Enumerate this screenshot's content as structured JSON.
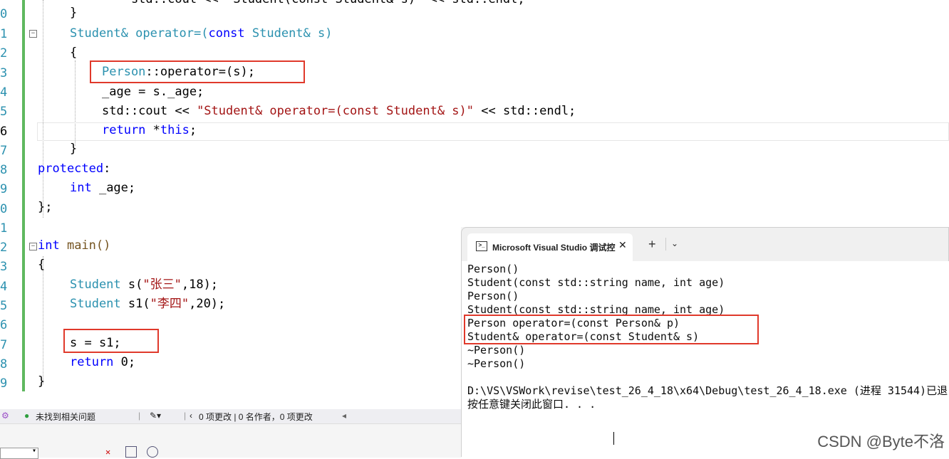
{
  "editor": {
    "line_numbers": [
      "0",
      "1",
      "2",
      "3",
      "4",
      "5",
      "6",
      "7",
      "8",
      "9",
      "0",
      "1",
      "2",
      "3",
      "4",
      "5",
      "6",
      "7",
      "8",
      "9"
    ],
    "line0": "    std::cout << \"Student(const Student& s)\" << std::endl;",
    "line1": "}",
    "l_student_ref": "Student& operator=(",
    "l_const": "const",
    "l_student_s": " Student& s)",
    "brace_open": "{",
    "person": "Person",
    "person_op": "::operator=(s);",
    "age_assign": "_age = s._age;",
    "cout_a": "std::cout << ",
    "cout_str": "\"Student& operator=(const Student& s)\"",
    "cout_b": " << std::endl;",
    "return_kw": "return",
    "return_this_a": " *",
    "this_kw": "this",
    "return_this_b": ";",
    "brace_close": "}",
    "protected": "protected",
    "colon": ":",
    "int_kw": "int",
    "age_decl": " _age;",
    "class_end": "};",
    "main_int": "int",
    "main_rest": " main()",
    "main_open": "{",
    "student_kw1": "Student",
    "s_decl_a": " s(",
    "s_decl_str": "\"张三\"",
    "s_decl_b": ",18);",
    "student_kw2": "Student",
    "s1_decl_a": " s1(",
    "s1_decl_str": "\"李四\"",
    "s1_decl_b": ",20);",
    "assign": "s = s1;",
    "ret_main_kw": "return",
    "ret_main_rest": " 0;",
    "main_close": "}"
  },
  "statusbar": {
    "issues": "未找到相关问题",
    "changes": "0 项更改 | 0 名作者，0 项更改"
  },
  "terminal": {
    "tab_title": "Microsoft Visual Studio 调试控",
    "lines": [
      "Person()",
      "Student(const std::string name, int age)",
      "Person()",
      "Student(const std::string name, int age)",
      "Person operator=(const Person& p)",
      "Student& operator=(const Student& s)",
      "~Person()",
      "~Person()",
      "",
      "D:\\VS\\VSWork\\revise\\test_26_4_18\\x64\\Debug\\test_26_4_18.exe (进程 31544)已退",
      "按任意键关闭此窗口. . ."
    ]
  },
  "watermark": "CSDN @Byte不洛",
  "colors": {
    "accent_green": "#5fb85f",
    "highlight_red": "#e0392b",
    "keyword_blue": "#0000ff",
    "type_teal": "#2b91af",
    "string_red": "#a31515"
  }
}
